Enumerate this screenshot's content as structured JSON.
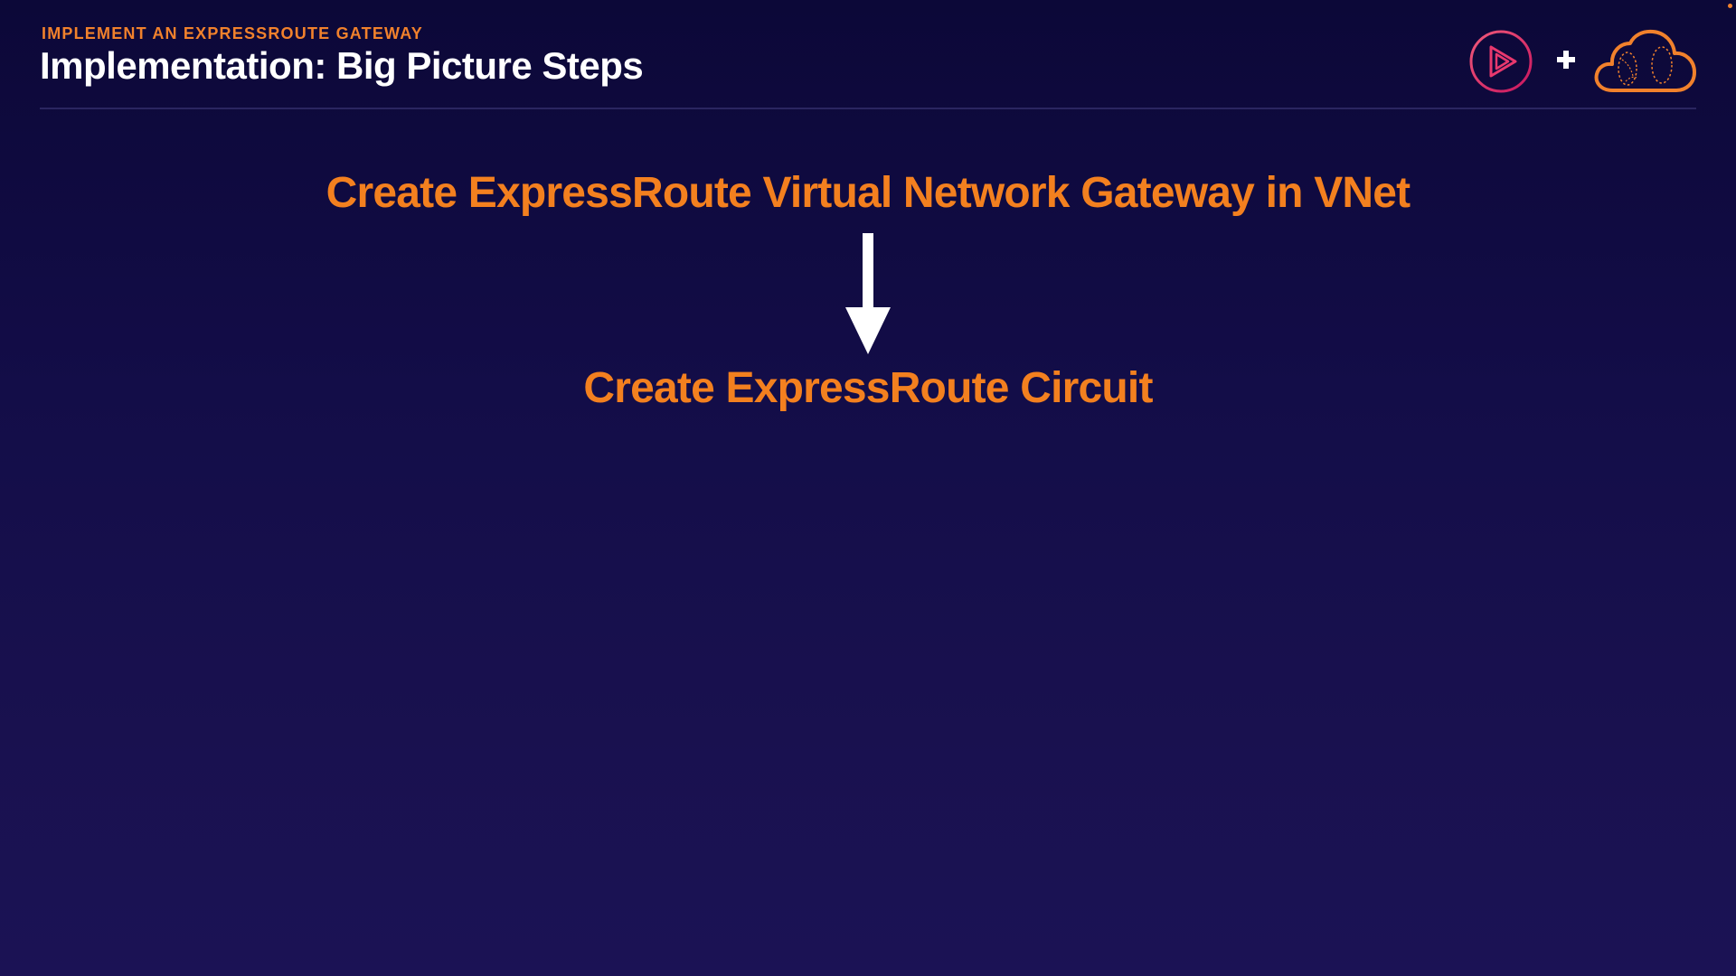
{
  "header": {
    "kicker": "IMPLEMENT AN EXPRESSROUTE GATEWAY",
    "title": "Implementation: Big Picture Steps"
  },
  "logos": {
    "items": [
      "play-logo-icon",
      "plus-icon",
      "cloud-logo-icon"
    ],
    "colors": {
      "play_ring": "#e0306a",
      "plus": "#ffffff",
      "cloud": "#f1812c"
    }
  },
  "flow": {
    "steps": [
      "Create ExpressRoute Virtual Network Gateway in VNet",
      "Create ExpressRoute Circuit"
    ],
    "connector": "arrow-down-icon"
  },
  "theme": {
    "background_top": "#0c0838",
    "background_bottom": "#1b1255",
    "accent": "#f3801f",
    "heading": "#ffffff"
  }
}
